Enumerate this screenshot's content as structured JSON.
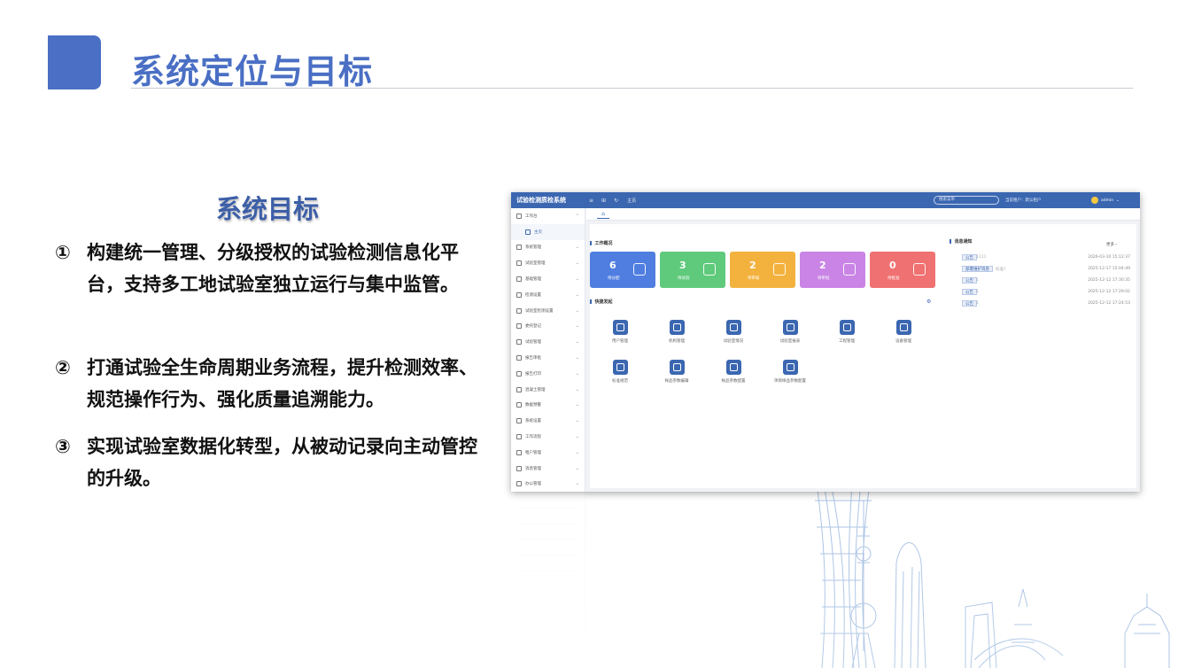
{
  "slide": {
    "title": "系统定位与目标",
    "goals_heading": "系统目标",
    "goals": [
      {
        "num": "①",
        "text": "构建统一管理、分级授权的试验检测信息化平台，支持多工地试验室独立运行与集中监管。"
      },
      {
        "num": "②",
        "text": "打通试验全生命周期业务流程，提升检测效率、规范操作行为、强化质量追溯能力。"
      },
      {
        "num": "③",
        "text": "实现试验室数据化转型，从被动记录向主动管控的升级。"
      }
    ]
  },
  "app": {
    "brand": "试验检测质检系统",
    "breadcrumb": "主页",
    "search_placeholder": "搜索菜单",
    "tenant_label": "当前租户：默认租户",
    "user": "admin",
    "home_tab_icon": "home-icon",
    "sidebar": [
      {
        "label": "工作台",
        "icon": "monitor-icon",
        "expanded": true
      },
      {
        "label": "主页",
        "icon": "home-icon",
        "sub": true
      },
      {
        "label": "系统管理",
        "icon": "lock-icon"
      },
      {
        "label": "试验室管理",
        "icon": "folder-icon"
      },
      {
        "label": "基础管理",
        "icon": "building-icon"
      },
      {
        "label": "检测设置",
        "icon": "form-icon"
      },
      {
        "label": "试验室检测设置",
        "icon": "edit-icon"
      },
      {
        "label": "委托登记",
        "icon": "tag-icon"
      },
      {
        "label": "试验管理",
        "icon": "flask-icon"
      },
      {
        "label": "报告审批",
        "icon": "report-icon"
      },
      {
        "label": "报告打印",
        "icon": "print-icon"
      },
      {
        "label": "混凝土管理",
        "icon": "grid-icon"
      },
      {
        "label": "数据预警",
        "icon": "alert-icon"
      },
      {
        "label": "系统设置",
        "icon": "gear-icon"
      },
      {
        "label": "工作流程",
        "icon": "flow-icon"
      },
      {
        "label": "租户管理",
        "icon": "home-icon"
      },
      {
        "label": "消息管理",
        "icon": "message-icon"
      },
      {
        "label": "办公管理",
        "icon": "user-icon"
      }
    ],
    "overview_title": "工作概况",
    "stats": [
      {
        "value": "6",
        "label": "待分配",
        "color": "#4f7ee0"
      },
      {
        "value": "3",
        "label": "待试验",
        "color": "#5fca7c"
      },
      {
        "value": "2",
        "label": "待审核",
        "color": "#f3b23e"
      },
      {
        "value": "2",
        "label": "待审批",
        "color": "#c984e5"
      },
      {
        "value": "0",
        "label": "待批准",
        "color": "#f07171"
      }
    ],
    "quick_title": "快捷发起",
    "quick_items": [
      {
        "label": "用户管理",
        "icon": "user-icon"
      },
      {
        "label": "机构管理",
        "icon": "org-icon"
      },
      {
        "label": "试验室情况",
        "icon": "lab-icon"
      },
      {
        "label": "试验室报表",
        "icon": "calculator-icon"
      },
      {
        "label": "工程管理",
        "icon": "building-icon"
      },
      {
        "label": "设备管理",
        "icon": "printer-icon"
      },
      {
        "label": "标准规范",
        "icon": "ruler-icon"
      },
      {
        "label": "样品参数编辑",
        "icon": "sample-icon"
      },
      {
        "label": "样品参数配置",
        "icon": "config-icon"
      },
      {
        "label": "项目样品参数配置",
        "icon": "network-icon"
      }
    ],
    "notice_title": "消息通知",
    "more_label": "更多 ›",
    "notices": [
      {
        "tag": "公告",
        "text": "1111",
        "date": "2026-03-10 15:12:37"
      },
      {
        "tag": "部署维护消息",
        "text": "标准?",
        "date": "2025-12-17 15:04:49"
      },
      {
        "tag": "公告",
        "text": "1",
        "date": "2025-12-12 17:30:35"
      },
      {
        "tag": "公告",
        "text": "1",
        "date": "2025-12-12 17:29:02"
      },
      {
        "tag": "公告",
        "text": "1",
        "date": "2025-12-12 17:24:53"
      }
    ]
  }
}
